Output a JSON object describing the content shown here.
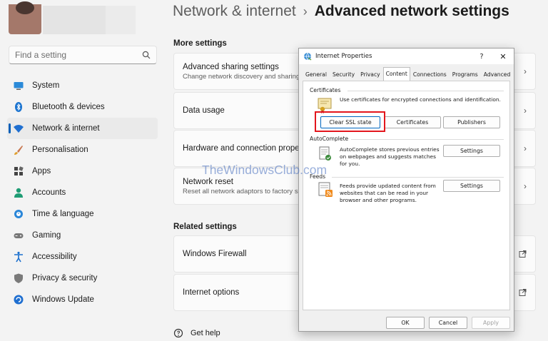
{
  "breadcrumb": {
    "parent": "Network & internet",
    "separator": "›",
    "current": "Advanced network settings"
  },
  "search": {
    "placeholder": "Find a setting"
  },
  "sidebar": {
    "items": [
      {
        "label": "System",
        "icon": "monitor-icon"
      },
      {
        "label": "Bluetooth & devices",
        "icon": "bluetooth-icon"
      },
      {
        "label": "Network & internet",
        "icon": "wifi-icon",
        "active": true
      },
      {
        "label": "Personalisation",
        "icon": "brush-icon"
      },
      {
        "label": "Apps",
        "icon": "apps-icon"
      },
      {
        "label": "Accounts",
        "icon": "person-icon"
      },
      {
        "label": "Time & language",
        "icon": "globe-clock-icon"
      },
      {
        "label": "Gaming",
        "icon": "gamepad-icon"
      },
      {
        "label": "Accessibility",
        "icon": "accessibility-icon"
      },
      {
        "label": "Privacy & security",
        "icon": "shield-icon"
      },
      {
        "label": "Windows Update",
        "icon": "update-icon"
      }
    ]
  },
  "main": {
    "more_settings_title": "More settings",
    "cards": [
      {
        "title": "Advanced sharing settings",
        "subtitle": "Change network discovery and sharing se"
      },
      {
        "title": "Data usage",
        "subtitle": ""
      },
      {
        "title": "Hardware and connection properties",
        "subtitle": ""
      },
      {
        "title": "Network reset",
        "subtitle": "Reset all network adaptors to factory set"
      }
    ],
    "related_settings_title": "Related settings",
    "related": [
      {
        "title": "Windows Firewall"
      },
      {
        "title": "Internet options"
      }
    ],
    "help_label": "Get help"
  },
  "dialog": {
    "title": "Internet Properties",
    "help_glyph": "?",
    "close_glyph": "✕",
    "tabs": [
      "General",
      "Security",
      "Privacy",
      "Content",
      "Connections",
      "Programs",
      "Advanced"
    ],
    "active_tab": "Content",
    "certificates": {
      "label": "Certificates",
      "description": "Use certificates for encrypted connections and identification.",
      "buttons": [
        "Clear SSL state",
        "Certificates",
        "Publishers"
      ]
    },
    "autocomplete": {
      "label": "AutoComplete",
      "description_lines": [
        "AutoComplete stores previous entries",
        "on webpages and suggests matches",
        "for you."
      ],
      "button": "Settings"
    },
    "feeds": {
      "label": "Feeds",
      "description_lines": [
        "Feeds provide updated content from",
        "websites that can be read in your",
        "browser and other programs."
      ],
      "button": "Settings"
    },
    "footer": {
      "ok": "OK",
      "cancel": "Cancel",
      "apply": "Apply"
    }
  },
  "watermark": "TheWindowsClub.com",
  "colors": {
    "accent": "#005fb8",
    "highlight": "#e3161d",
    "background": "#f3f3f3"
  }
}
